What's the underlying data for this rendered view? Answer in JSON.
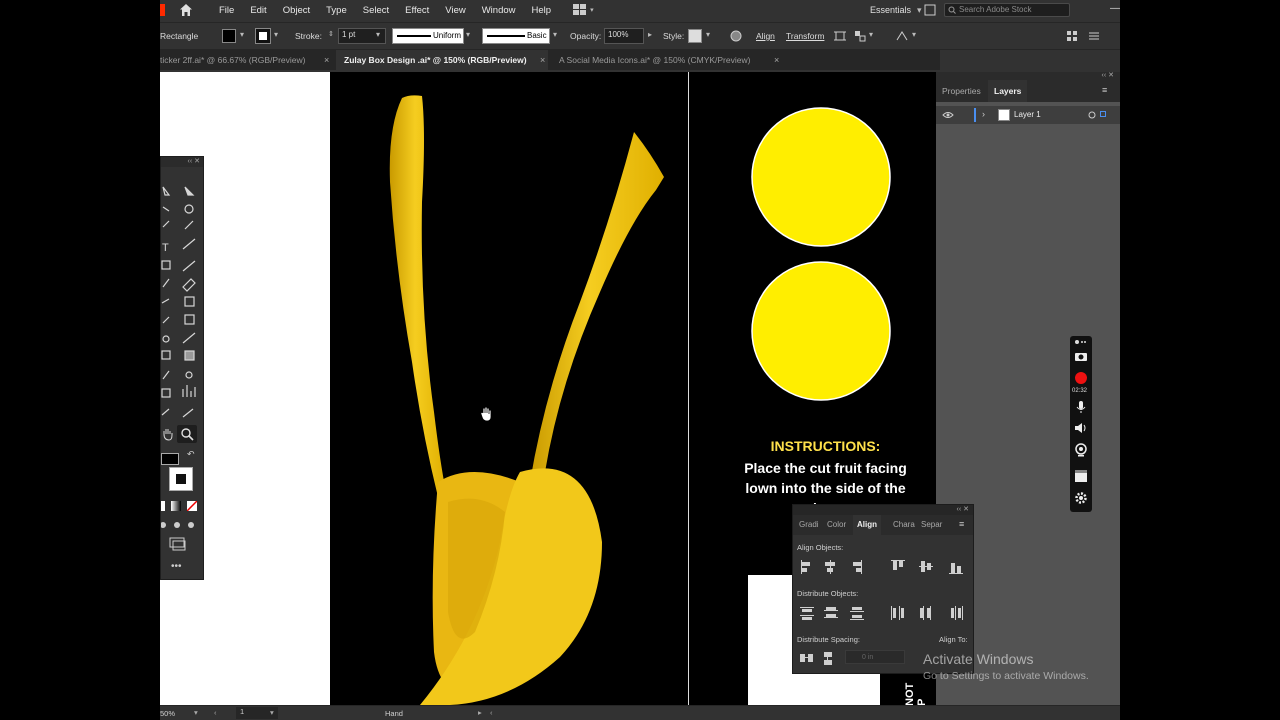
{
  "menubar": {
    "items": [
      "File",
      "Edit",
      "Object",
      "Type",
      "Select",
      "Effect",
      "View",
      "Window",
      "Help"
    ],
    "workspace": "Essentials",
    "search_placeholder": "Search Adobe Stock"
  },
  "controlbar": {
    "tool_name": "Rectangle",
    "stroke_label": "Stroke:",
    "stroke_value": "1 pt",
    "stroke_profile": "Uniform",
    "brush": "Basic",
    "opacity_label": "Opacity:",
    "opacity_value": "100%",
    "style_label": "Style:",
    "align_label": "Align",
    "transform_label": "Transform"
  },
  "tabs": [
    {
      "label": "ticker 2ff.ai* @ 66.67% (RGB/Preview)"
    },
    {
      "label": "Zulay Box Design .ai* @ 150% (RGB/Preview)"
    },
    {
      "label": "A Social Media Icons.ai* @ 150% (CMYK/Preview)"
    }
  ],
  "canvas": {
    "instructions_title": "INSTRUCTIONS:",
    "instructions_line1": "Place the cut fruit facing",
    "instructions_line2": "lown into the side of the",
    "instructions_line3": "bov",
    "vertical_text": "NOT P",
    "colors": {
      "yellow": "#ffee00",
      "squeezer": "#f2c81a",
      "title_yellow": "#ffe14b"
    }
  },
  "right_panel": {
    "tabs": [
      "Properties",
      "Layers"
    ],
    "active_tab": "Layers",
    "layer_name": "Layer 1"
  },
  "align_panel": {
    "tabs": [
      "Gradi",
      "Color",
      "Align",
      "Chara",
      "Separ"
    ],
    "active_tab": "Align",
    "align_objects_label": "Align Objects:",
    "distribute_objects_label": "Distribute Objects:",
    "distribute_spacing_label": "Distribute Spacing:",
    "align_to_label": "Align To:",
    "spacing_value": "0 in"
  },
  "statusbar": {
    "zoom": "50%",
    "artboard": "1",
    "tool": "Hand"
  },
  "recorder": {
    "timer": "02:32"
  },
  "watermark": {
    "title": "Activate Windows",
    "subtitle": "Go to Settings to activate Windows."
  }
}
